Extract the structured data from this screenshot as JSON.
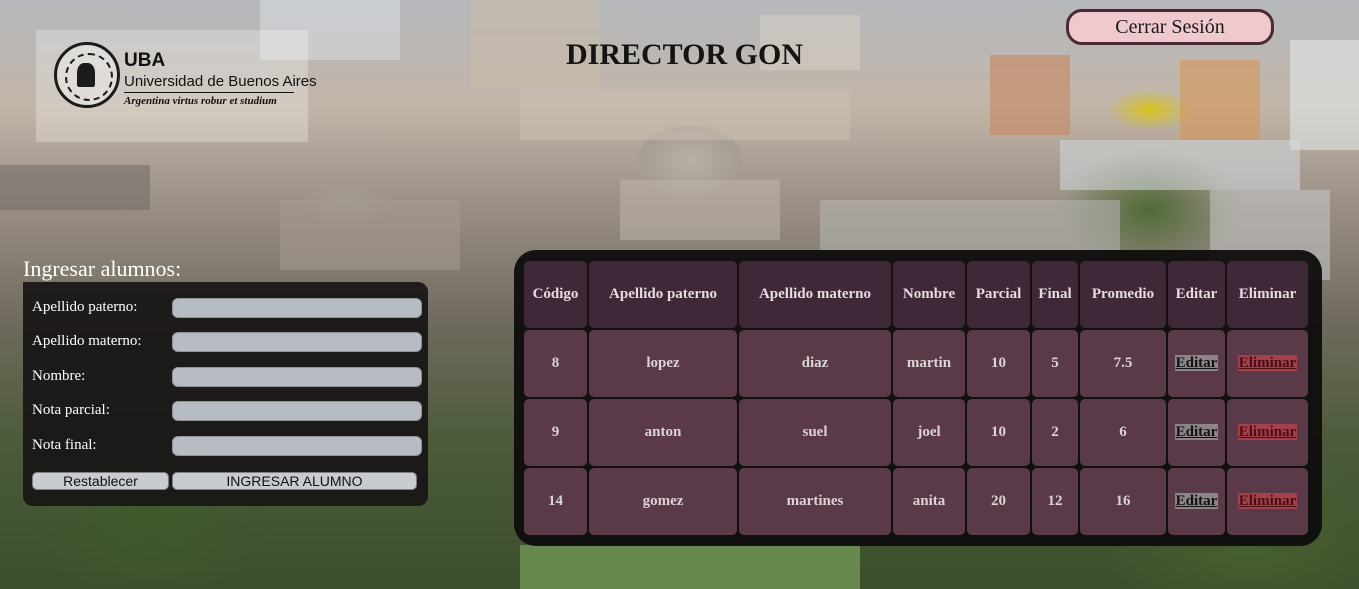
{
  "header": {
    "logo": {
      "short": "UBA",
      "name": "Universidad de Buenos Aires",
      "motto": "Argentina virtus robur et studium"
    },
    "title": "DIRECTOR GON",
    "logout_label": "Cerrar Sesión"
  },
  "form": {
    "title": "Ingresar alumnos:",
    "fields": [
      {
        "label": "Apellido paterno:",
        "value": ""
      },
      {
        "label": "Apellido materno:",
        "value": ""
      },
      {
        "label": "Nombre:",
        "value": ""
      },
      {
        "label": "Nota parcial:",
        "value": ""
      },
      {
        "label": "Nota final:",
        "value": ""
      }
    ],
    "reset_label": "Restablecer",
    "submit_label": "INGRESAR ALUMNO"
  },
  "table": {
    "headers": [
      "Código",
      "Apellido paterno",
      "Apellido materno",
      "Nombre",
      "Parcial",
      "Final",
      "Promedio",
      "Editar",
      "Eliminar"
    ],
    "rows": [
      {
        "codigo": "8",
        "paterno": "lopez",
        "materno": "diaz",
        "nombre": "martin",
        "parcial": "10",
        "final": "5",
        "promedio": "7.5",
        "editar": "Editar",
        "eliminar": "Eliminar"
      },
      {
        "codigo": "9",
        "paterno": "anton",
        "materno": "suel",
        "nombre": "joel",
        "parcial": "10",
        "final": "2",
        "promedio": "6",
        "editar": "Editar",
        "eliminar": "Eliminar"
      },
      {
        "codigo": "14",
        "paterno": "gomez",
        "materno": "martines",
        "nombre": "anita",
        "parcial": "20",
        "final": "12",
        "promedio": "16",
        "editar": "Editar",
        "eliminar": "Eliminar"
      }
    ]
  },
  "colors": {
    "header_cell": "#3f2838",
    "body_cell": "#5a3a48",
    "logout_bg": "#f0c9cf",
    "delete_link": "#a3414c"
  }
}
